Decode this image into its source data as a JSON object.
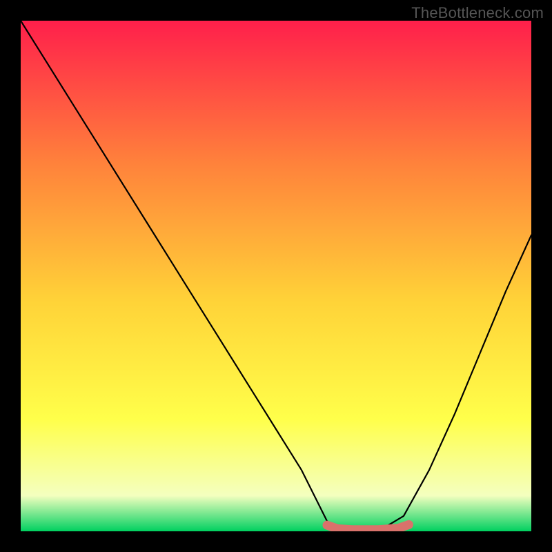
{
  "watermark": "TheBottleneck.com",
  "chart_data": {
    "type": "line",
    "title": "",
    "xlabel": "",
    "ylabel": "",
    "xlim": [
      0,
      100
    ],
    "ylim": [
      0,
      100
    ],
    "gradient_colors": {
      "top": "#ff1f4b",
      "upper_mid": "#ff823b",
      "mid": "#ffd338",
      "lower_mid": "#ffff4a",
      "near_bottom": "#f4ffbf",
      "bottom": "#00d060"
    },
    "series": [
      {
        "name": "bottleneck-curve",
        "color": "#000000",
        "x": [
          0,
          5,
          10,
          15,
          20,
          25,
          30,
          35,
          40,
          45,
          50,
          55,
          60,
          62,
          65,
          70,
          75,
          80,
          85,
          90,
          95,
          100
        ],
        "values": [
          100,
          92,
          84,
          76,
          68,
          60,
          52,
          44,
          36,
          28,
          20,
          12,
          2,
          0,
          0,
          0,
          3,
          12,
          23,
          35,
          47,
          58
        ]
      }
    ],
    "highlight_band": {
      "name": "sweet-spot",
      "color": "#d9726b",
      "x": [
        60,
        62,
        65,
        70,
        74,
        76
      ],
      "values": [
        1.2,
        0.5,
        0.3,
        0.3,
        0.6,
        1.3
      ]
    }
  }
}
